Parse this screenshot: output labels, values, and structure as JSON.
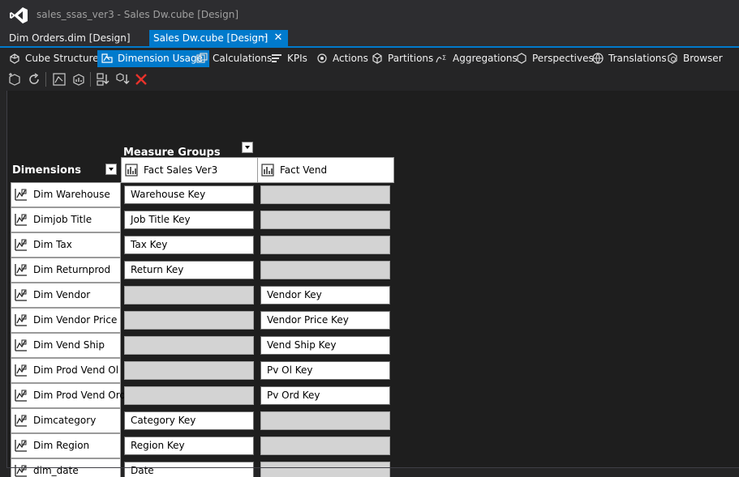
{
  "window": {
    "title": "sales_ssas_ver3 - Sales Dw.cube [Design]"
  },
  "doc_tabs": [
    {
      "label": "Dim Orders.dim [Design]",
      "active": false
    },
    {
      "label": "Sales Dw.cube [Design]",
      "active": true
    }
  ],
  "designer_tabs": [
    {
      "label": "Cube Structure",
      "icon": "cube-structure-icon"
    },
    {
      "label": "Dimension Usage",
      "icon": "dimension-usage-icon",
      "selected": true
    },
    {
      "label": "Calculations",
      "icon": "calculations-icon"
    },
    {
      "label": "KPIs",
      "icon": "kpis-icon"
    },
    {
      "label": "Actions",
      "icon": "actions-icon"
    },
    {
      "label": "Partitions",
      "icon": "partitions-icon"
    },
    {
      "label": "Aggregations",
      "icon": "aggregations-icon"
    },
    {
      "label": "Perspectives",
      "icon": "perspectives-icon"
    },
    {
      "label": "Translations",
      "icon": "translations-icon"
    },
    {
      "label": "Browser",
      "icon": "browser-icon"
    }
  ],
  "toolbar_icons": [
    "add-cube-dimension-icon",
    "refresh-icon",
    "show-all-dimensions-icon",
    "show-measure-groups-icon",
    "sort-dimensions-icon",
    "sort-measure-groups-icon",
    "delete-icon"
  ],
  "grid": {
    "measure_groups_label": "Measure Groups",
    "dimensions_label": "Dimensions",
    "measure_groups": [
      "Fact Sales Ver3",
      "Fact Vend"
    ],
    "rows": [
      {
        "dimension": "Dim Warehouse",
        "cells": [
          "Warehouse Key",
          ""
        ]
      },
      {
        "dimension": "Dimjob Title",
        "cells": [
          "Job Title Key",
          ""
        ]
      },
      {
        "dimension": "Dim Tax",
        "cells": [
          "Tax Key",
          ""
        ]
      },
      {
        "dimension": "Dim Returnprod",
        "cells": [
          "Return Key",
          ""
        ]
      },
      {
        "dimension": "Dim Vendor",
        "cells": [
          "",
          "Vendor Key"
        ]
      },
      {
        "dimension": "Dim Vendor Price",
        "cells": [
          "",
          "Vendor Price Key"
        ]
      },
      {
        "dimension": "Dim Vend Ship",
        "cells": [
          "",
          "Vend Ship Key"
        ]
      },
      {
        "dimension": "Dim Prod Vend Ol",
        "cells": [
          "",
          "Pv Ol Key"
        ]
      },
      {
        "dimension": "Dim Prod Vend Ord",
        "cells": [
          "",
          "Pv Ord Key"
        ]
      },
      {
        "dimension": "Dimcategory",
        "cells": [
          "Category Key",
          ""
        ]
      },
      {
        "dimension": "Dim Region",
        "cells": [
          "Region Key",
          ""
        ]
      },
      {
        "dimension": "dim_date",
        "cells": [
          "Date",
          ""
        ]
      }
    ]
  },
  "colors": {
    "accent": "#007acc",
    "background": "#2d2d30",
    "empty_cell": "#d3d3d3"
  }
}
